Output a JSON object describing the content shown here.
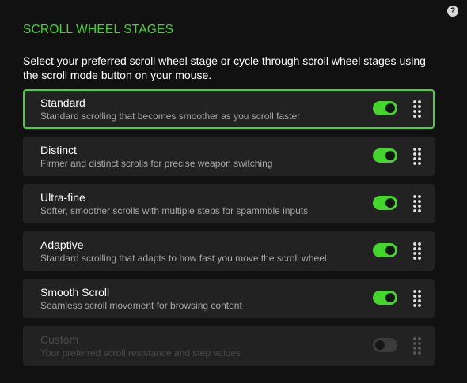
{
  "header": {
    "title": "SCROLL WHEEL STAGES",
    "help_icon": "question-mark-icon",
    "help_glyph": "?"
  },
  "description": "Select your preferred scroll wheel stage or cycle through scroll wheel stages using the scroll mode button on your mouse.",
  "colors": {
    "accent": "#44d62c",
    "background": "#111111",
    "card": "#222222",
    "muted_text": "#a8a8a8",
    "disabled_text": "#4a4a4a"
  },
  "stages": [
    {
      "name": "Standard",
      "description": "Standard scrolling that becomes smoother as you scroll faster",
      "enabled": true,
      "selected": true
    },
    {
      "name": "Distinct",
      "description": "Firmer and distinct scrolls for precise weapon switching",
      "enabled": true,
      "selected": false
    },
    {
      "name": "Ultra-fine",
      "description": "Softer, smoother scrolls with multiple steps for spammble inputs",
      "enabled": true,
      "selected": false
    },
    {
      "name": "Adaptive",
      "description": "Standard scrolling that adapts to how fast you move the scroll wheel",
      "enabled": true,
      "selected": false
    },
    {
      "name": "Smooth Scroll",
      "description": "Seamless scroll movement for browsing content",
      "enabled": true,
      "selected": false
    },
    {
      "name": "Custom",
      "description": "Your preferred scroll resistance and step values",
      "enabled": false,
      "selected": false
    }
  ]
}
